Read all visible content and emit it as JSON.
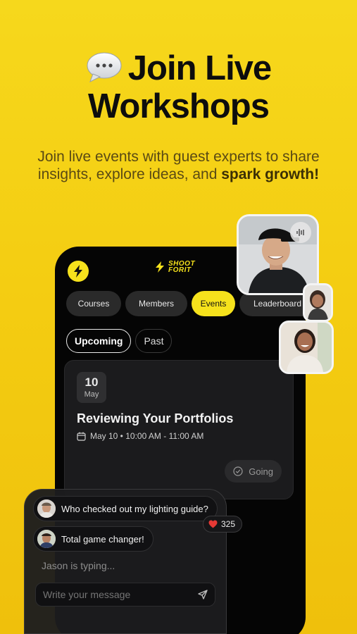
{
  "hero": {
    "title_line1": "Join Live",
    "title_line2": "Workshops",
    "subtitle_plain": "Join live events with guest experts to share insights, explore ideas, and ",
    "subtitle_bold": "spark growth!"
  },
  "app": {
    "brand": "SHOOT FORIT",
    "tabs": [
      {
        "label": "Courses",
        "active": false
      },
      {
        "label": "Members",
        "active": false
      },
      {
        "label": "Events",
        "active": true
      },
      {
        "label": "Leaderboard",
        "active": false
      }
    ],
    "filters": [
      {
        "label": "Upcoming",
        "active": true
      },
      {
        "label": "Past",
        "active": false
      }
    ],
    "event": {
      "day": "10",
      "month": "May",
      "title": "Reviewing Your Portfolios",
      "time": "May 10 • 10:00 AM - 11:00 AM",
      "going_label": "Going"
    }
  },
  "chat": {
    "messages": [
      {
        "text": "Who checked out my lighting guide?"
      },
      {
        "text": "Total game changer!"
      }
    ],
    "likes": "325",
    "typing": "Jason is typing...",
    "input_placeholder": "Write your message"
  },
  "icons": {
    "hero": "speech-bubble-icon",
    "logo": "lightning-logo-icon",
    "calendar": "calendar-icon",
    "going": "check-circle-icon",
    "audio": "audio-wave-icon",
    "heart": "heart-icon",
    "send": "send-icon"
  },
  "colors": {
    "accent": "#f6e21c",
    "background": "#f4cd12",
    "phone": "#050505",
    "heart": "#e53935"
  }
}
